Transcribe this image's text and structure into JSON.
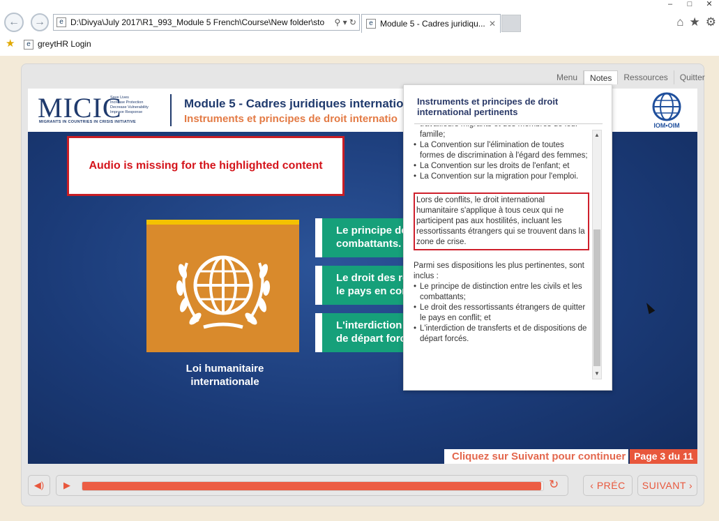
{
  "browser": {
    "address": "D:\\Divya\\July 2017\\R1_993_Module 5 French\\Course\\New folder\\sto",
    "tab_title": "Module 5 - Cadres juridiqu...",
    "favorite": "greytHR Login"
  },
  "top_menu": {
    "menu": "Menu",
    "notes": "Notes",
    "resources": "Ressources",
    "quit": "Quitter"
  },
  "header": {
    "logo_text": "MICIC",
    "logo_tagline": [
      "Save Lives",
      "Increase Protection",
      "Decrease Vulnerability",
      "Improve Response"
    ],
    "logo_subtitle": "MIGRANTS IN COUNTRIES IN CRISIS INITIATIVE",
    "module_title": "Module 5 - Cadres juridiques internation",
    "module_subtitle": "Instruments et principes de droit internatio",
    "iom_label": "IOM•OIM"
  },
  "slide": {
    "audio_warning": "Audio is missing for the highlighted content",
    "card_label": "Loi humanitaire internationale",
    "items": [
      {
        "line1": "Le principe de",
        "line2": "combattants."
      },
      {
        "line1": "Le droit des re",
        "line2": "le pays en con"
      },
      {
        "line1": "L'interdiction",
        "line2": "de départ forc"
      }
    ],
    "continue_text": "Cliquez sur Suivant pour continuer",
    "page_indicator": "Page 3 du 11"
  },
  "notes": {
    "title": "Instruments et principes de droit international pertinents",
    "top_bullets": [
      "travailleurs migrants et des membres de leur famille;",
      "La Convention sur l'élimination de toutes formes de discrimination à l'égard des femmes;",
      "La Convention sur les droits de l'enfant; et",
      "La Convention sur la migration pour l'emploi."
    ],
    "highlighted_para": "Lors de conflits, le droit international humanitaire s'applique à tous ceux qui ne participent pas aux hostilités, incluant les ressortissants étrangers qui se trouvent dans la zone de crise.",
    "intro_para": "Parmi ses dispositions les plus pertinentes, sont inclus :",
    "bottom_bullets": [
      "Le principe de distinction entre les civils et les combattants;",
      "Le droit des ressortissants étrangers de quitter le pays en conflit; et",
      "L'interdiction de transferts et de dispositions de départ forcés."
    ]
  },
  "controls": {
    "progress_fraction": 0.995,
    "prev_label": "PRÉC",
    "next_label": "SUIVANT"
  }
}
